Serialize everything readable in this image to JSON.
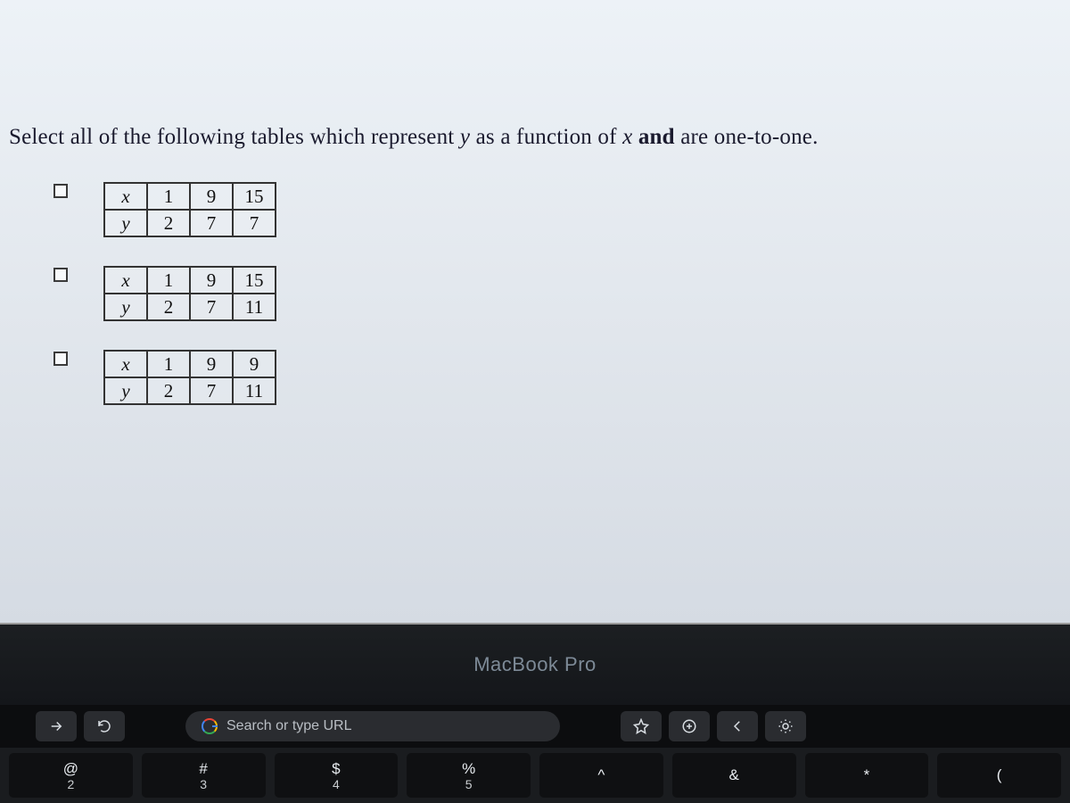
{
  "question": {
    "prefix": "Select all of the following tables which represent ",
    "y": "y",
    "mid1": " as a function of ",
    "x": "x",
    "mid2": " and",
    "suffix": " are one-to-one."
  },
  "options": [
    {
      "xlabel": "x",
      "ylabel": "y",
      "x": [
        "1",
        "9",
        "15"
      ],
      "y": [
        "2",
        "7",
        "7"
      ]
    },
    {
      "xlabel": "x",
      "ylabel": "y",
      "x": [
        "1",
        "9",
        "15"
      ],
      "y": [
        "2",
        "7",
        "11"
      ]
    },
    {
      "xlabel": "x",
      "ylabel": "y",
      "x": [
        "1",
        "9",
        "9"
      ],
      "y": [
        "2",
        "7",
        "11"
      ]
    }
  ],
  "device_label": "MacBook Pro",
  "touchbar": {
    "search_placeholder": "Search or type URL"
  },
  "keys": [
    {
      "sym": "@",
      "num": "2"
    },
    {
      "sym": "#",
      "num": "3"
    },
    {
      "sym": "$",
      "num": "4"
    },
    {
      "sym": "%",
      "num": "5"
    },
    {
      "sym": "^",
      "num": ""
    },
    {
      "sym": "&",
      "num": ""
    },
    {
      "sym": "*",
      "num": ""
    },
    {
      "sym": "(",
      "num": ""
    }
  ]
}
